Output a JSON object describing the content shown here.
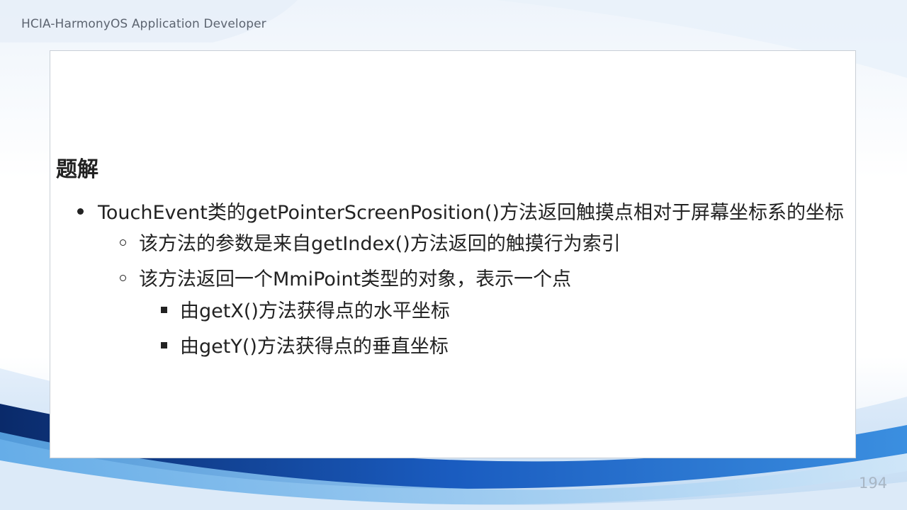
{
  "header": {
    "text": "HCIA-HarmonyOS Application Developer"
  },
  "slide": {
    "section_title": "题解",
    "bullets": [
      {
        "level": 1,
        "text": "TouchEvent类的getPointerScreenPosition()方法返回触摸点相对于屏幕坐标系的坐标"
      },
      {
        "level": 2,
        "text": "该方法的参数是来自getIndex()方法返回的触摸行为索引"
      },
      {
        "level": 2,
        "text": "该方法返回一个MmiPoint类型的对象，表示一个点"
      },
      {
        "level": 3,
        "text": "由getX()方法获得点的水平坐标"
      },
      {
        "level": 3,
        "text": "由getY()方法获得点的垂直坐标"
      }
    ]
  },
  "footer": {
    "page_number": "194"
  },
  "colors": {
    "accent_blue": "#1f5fb0",
    "dark_blue": "#0b2a66",
    "text": "#222222"
  }
}
